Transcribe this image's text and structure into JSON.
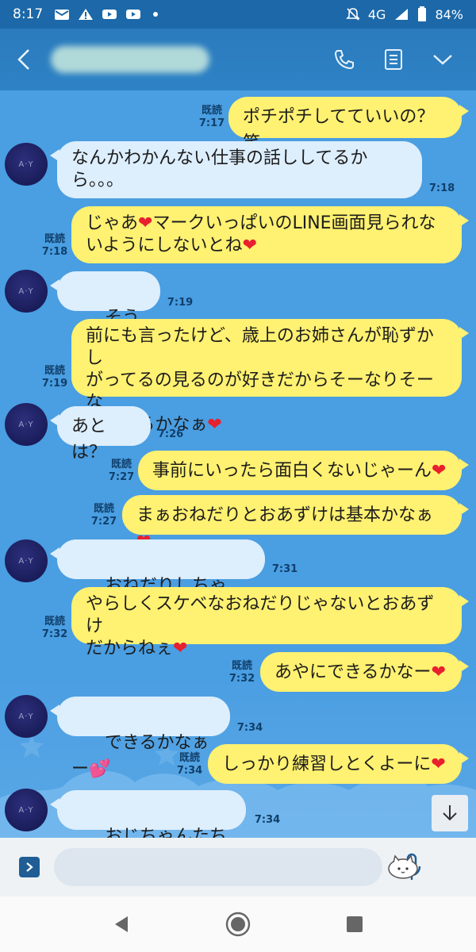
{
  "status_bar": {
    "time": "8:17",
    "network": "4G",
    "battery": "84%"
  },
  "header": {
    "contact_name": "",
    "icons": [
      "chevron-left-icon",
      "phone-icon",
      "notes-icon",
      "chevron-down-icon"
    ]
  },
  "messages": [
    {
      "side": "out",
      "text": "ポチポチしてていいの？笑",
      "read": "既読",
      "time": "7:17"
    },
    {
      "side": "in",
      "text": "なんかわかんない仕事の話ししてるか\nら。。。",
      "time": "7:18"
    },
    {
      "side": "out",
      "text": "じゃあ❤マークいっぱいのLINE画面見られな\nいようにしないとね❤",
      "read": "既読",
      "time": "7:18"
    },
    {
      "side": "in",
      "text": "そうね",
      "time": "7:19"
    },
    {
      "side": "out",
      "text": "前にも言ったけど、歳上のお姉さんが恥ずかし\nがってるの見るのが好きだからそーなりそーな\nことするかなぁ❤",
      "read": "既読",
      "time": "7:19"
    },
    {
      "side": "in",
      "text": "あとは？",
      "time": "7:26"
    },
    {
      "side": "out",
      "text": "事前にいったら面白くないじゃーん❤",
      "read": "既読",
      "time": "7:27"
    },
    {
      "side": "out",
      "text": "まぁおねだりとおあずけは基本かなぁ❤",
      "read": "既読",
      "time": "7:27"
    },
    {
      "side": "in",
      "text": "おねだりしちゃう〜",
      "time": "7:31"
    },
    {
      "side": "out",
      "text": "やらしくスケベなおねだりじゃないとおあずけ\nだからねぇ❤",
      "read": "既読",
      "time": "7:32"
    },
    {
      "side": "out",
      "text": "あやにできるかなー❤",
      "read": "既読",
      "time": "7:32"
    },
    {
      "side": "in",
      "text": "できるかなぁー",
      "time": "7:34"
    },
    {
      "side": "out",
      "text": "しっかり練習しとくよーに❤",
      "read": "既読",
      "time": "7:34"
    },
    {
      "side": "in",
      "text": "おじちゃんたちで",
      "time": "7:34"
    }
  ],
  "avatar_initials": "A·Y",
  "input": {
    "placeholder": "",
    "value": ""
  },
  "colors": {
    "header": "#2b7bbd",
    "chat_bg": "#4a9ee2",
    "bubble_out": "#fff171",
    "bubble_in": "#ddeefd"
  }
}
